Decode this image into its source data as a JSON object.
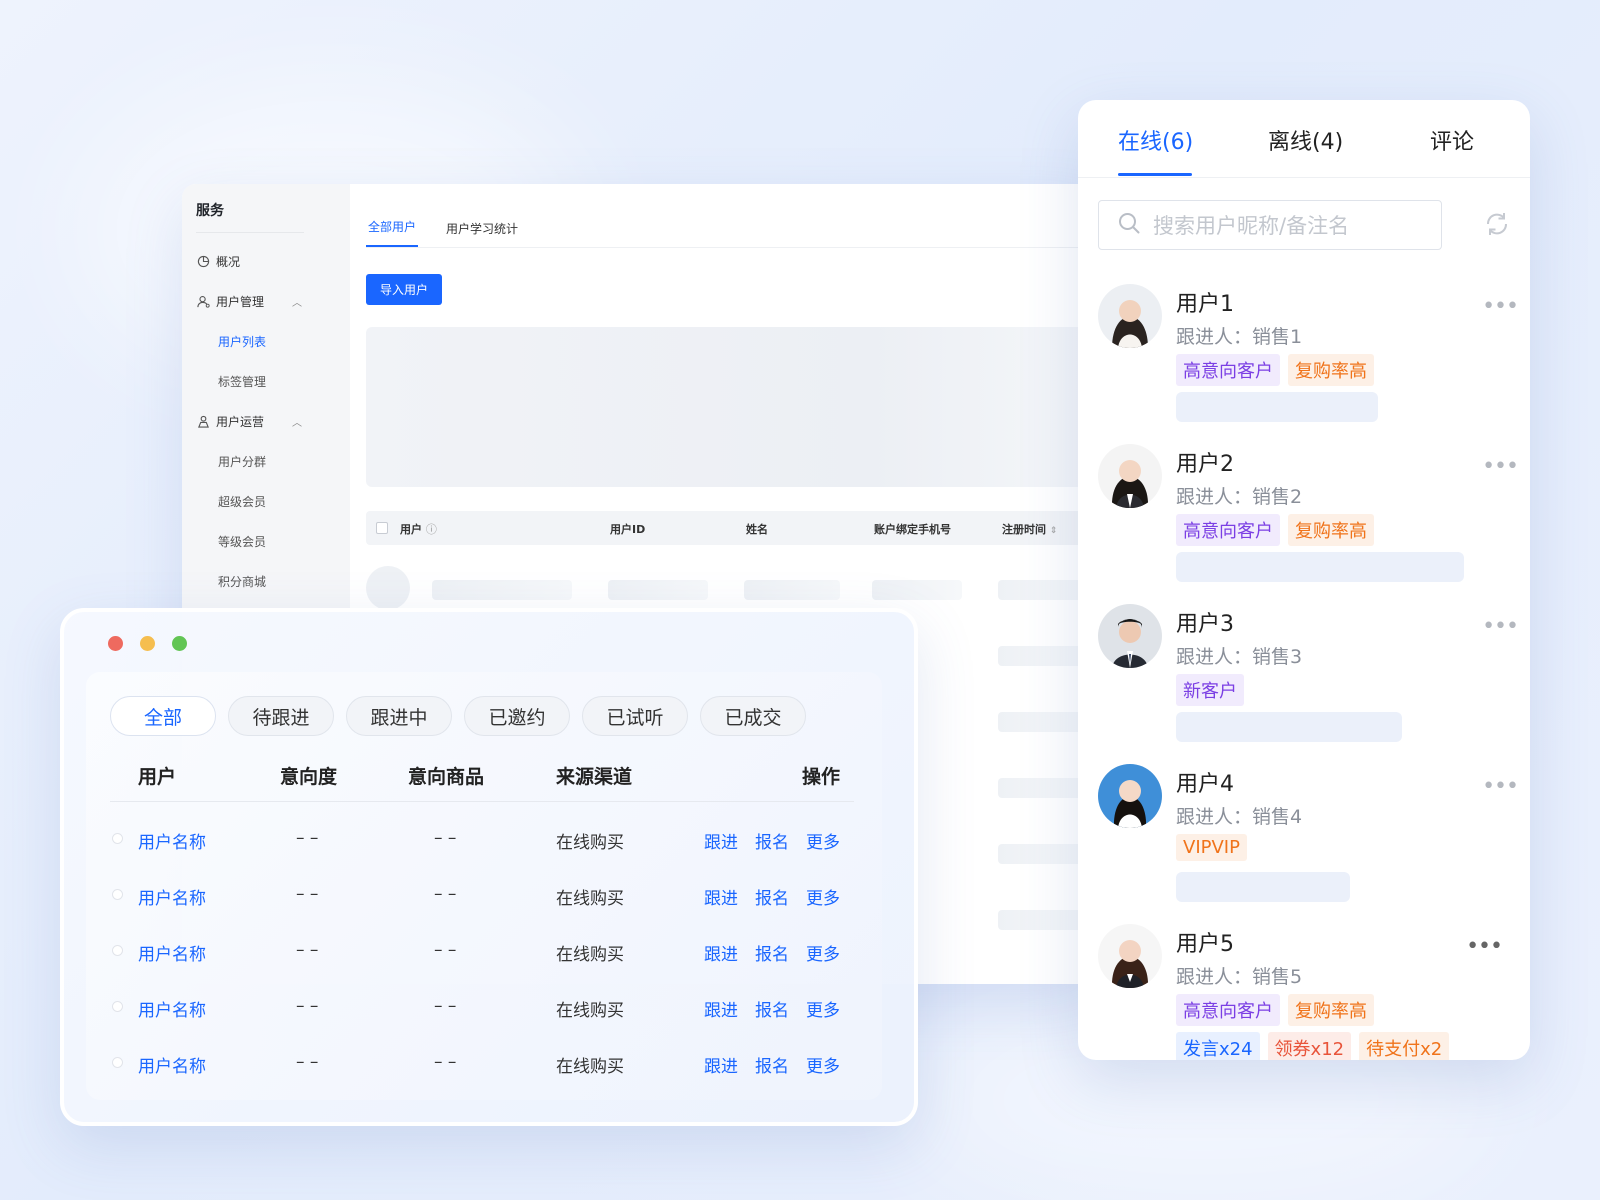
{
  "admin": {
    "section_title": "服务",
    "nav": [
      {
        "label": "概况",
        "icon": "pie-chart-icon"
      },
      {
        "label": "用户管理",
        "icon": "user-manage-icon",
        "expanded": true,
        "children": [
          "用户列表",
          "标签管理"
        ],
        "active_child": "用户列表"
      },
      {
        "label": "用户运营",
        "icon": "user-ops-icon",
        "expanded": true,
        "children": [
          "用户分群",
          "超级会员",
          "等级会员",
          "积分商城"
        ]
      }
    ],
    "tabs": [
      "全部用户",
      "用户学习统计"
    ],
    "active_tab": "全部用户",
    "import_button": "导入用户",
    "table_headers": [
      "用户",
      "用户ID",
      "姓名",
      "账户绑定手机号",
      "注册时间"
    ]
  },
  "panel": {
    "tabs": [
      "在线(6)",
      "离线(4)",
      "评论"
    ],
    "active_tab": "在线(6)",
    "search_placeholder": "搜索用户昵称/备注名",
    "users": [
      {
        "name": "用户1",
        "follow_label": "跟进人：",
        "follower": "销售1",
        "tags": [
          {
            "text": "高意向客户",
            "color": "#7b3fe4",
            "bg": "#f1ebfd"
          },
          {
            "text": "复购率高",
            "color": "#f0731a",
            "bg": "#fdf0e6"
          }
        ]
      },
      {
        "name": "用户2",
        "follow_label": "跟进人：",
        "follower": "销售2",
        "tags": [
          {
            "text": "高意向客户",
            "color": "#7b3fe4",
            "bg": "#f1ebfd"
          },
          {
            "text": "复购率高",
            "color": "#f0731a",
            "bg": "#fdf0e6"
          }
        ]
      },
      {
        "name": "用户3",
        "follow_label": "跟进人：",
        "follower": "销售3",
        "tags": [
          {
            "text": "新客户",
            "color": "#7b3fe4",
            "bg": "#f1ebfd"
          }
        ]
      },
      {
        "name": "用户4",
        "follow_label": "跟进人：",
        "follower": "销售4",
        "tags": [
          {
            "text": "VIPVIP",
            "color": "#f0731a",
            "bg": "#fdf0e6"
          }
        ]
      },
      {
        "name": "用户5",
        "follow_label": "跟进人：",
        "follower": "销售5",
        "tags": [
          {
            "text": "高意向客户",
            "color": "#7b3fe4",
            "bg": "#f1ebfd"
          },
          {
            "text": "复购率高",
            "color": "#f0731a",
            "bg": "#fdf0e6"
          }
        ],
        "extra_tags": [
          {
            "text": "发言x24",
            "color": "#1a66ff",
            "bg": "#e8f0ff"
          },
          {
            "text": "领券x12",
            "color": "#e8543a",
            "bg": "#fdece8"
          },
          {
            "text": "待支付x2",
            "color": "#f0731a",
            "bg": "#fdf0e6"
          }
        ]
      }
    ]
  },
  "front": {
    "filters": [
      "全部",
      "待跟进",
      "跟进中",
      "已邀约",
      "已试听",
      "已成交"
    ],
    "active_filter": "全部",
    "headers": [
      "用户",
      "意向度",
      "意向商品",
      "来源渠道",
      "操作"
    ],
    "rows": [
      {
        "user": "用户名称",
        "intent": "– –",
        "product": "– –",
        "channel": "在线购买"
      },
      {
        "user": "用户名称",
        "intent": "– –",
        "product": "– –",
        "channel": "在线购买"
      },
      {
        "user": "用户名称",
        "intent": "– –",
        "product": "– –",
        "channel": "在线购买"
      },
      {
        "user": "用户名称",
        "intent": "– –",
        "product": "– –",
        "channel": "在线购买"
      },
      {
        "user": "用户名称",
        "intent": "– –",
        "product": "– –",
        "channel": "在线购买"
      }
    ],
    "actions": [
      "跟进",
      "报名",
      "更多"
    ]
  },
  "colors": {
    "accent": "#1a66ff",
    "mac_red": "#ee6a5f",
    "mac_yellow": "#f5be4f",
    "mac_green": "#62c554"
  }
}
